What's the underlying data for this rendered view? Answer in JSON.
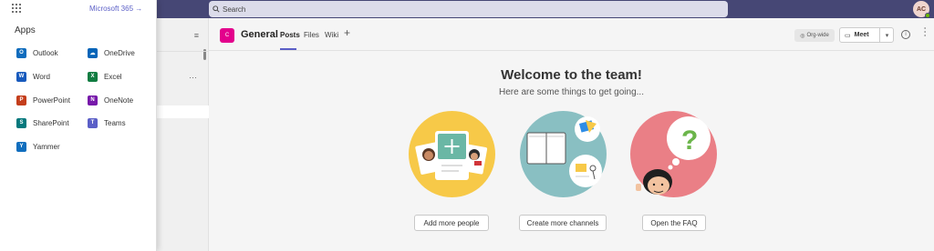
{
  "topbar": {
    "search_label": "Search",
    "avatar_initials": "AC",
    "colors": {
      "bar": "#464775",
      "presence": "#6bb700"
    }
  },
  "apps_panel": {
    "m365_link": "Microsoft 365",
    "arrow": "→",
    "heading": "Apps",
    "items": [
      {
        "label": "Outlook",
        "icon": "outlook-icon",
        "color": "#0f6cbd"
      },
      {
        "label": "OneDrive",
        "icon": "onedrive-icon",
        "color": "#0364b8"
      },
      {
        "label": "Word",
        "icon": "word-icon",
        "color": "#185abd"
      },
      {
        "label": "Excel",
        "icon": "excel-icon",
        "color": "#107c41"
      },
      {
        "label": "PowerPoint",
        "icon": "powerpoint-icon",
        "color": "#c43e1c"
      },
      {
        "label": "OneNote",
        "icon": "onenote-icon",
        "color": "#7719aa"
      },
      {
        "label": "SharePoint",
        "icon": "sharepoint-icon",
        "color": "#03787c"
      },
      {
        "label": "Teams",
        "icon": "teams-icon",
        "color": "#5b5fc7"
      },
      {
        "label": "Yammer",
        "icon": "yammer-icon",
        "color": "#106ebe"
      }
    ]
  },
  "channel_header": {
    "team_avatar": "C",
    "channel_name": "General",
    "tabs": [
      "Posts",
      "Files",
      "Wiki"
    ],
    "add_tab": "+",
    "org_wide": "Org-wide",
    "meet_label": "Meet"
  },
  "welcome": {
    "title": "Welcome to the team!",
    "subtitle": "Here are some things to get going...",
    "actions": [
      {
        "label": "Add more people"
      },
      {
        "label": "Create more channels"
      },
      {
        "label": "Open the FAQ"
      }
    ]
  }
}
